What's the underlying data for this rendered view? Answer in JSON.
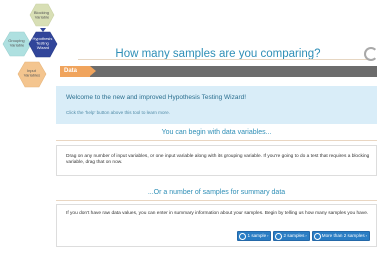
{
  "hex_menu": {
    "blocking": "Blocking\nVariable",
    "grouping": "Grouping\nVariable",
    "wizard": "Hypothesis\nTesting\nWizard",
    "input": "Input\nVariables"
  },
  "header": {
    "title": "How many samples are you comparing?"
  },
  "steps": {
    "active": "Data"
  },
  "welcome": {
    "title": "Welcome to the new and improved Hypothesis Testing Wizard!",
    "subtitle": "Click the 'help' button above this tool to learn more."
  },
  "section1": {
    "heading": "You can begin with data variables...",
    "text": "Drag on any number of input variables, or one input variable along with its grouping variable. If you're going to do a test that requires a blocking variable, drag that on now."
  },
  "section2": {
    "heading": "...Or a number of samples for summary data",
    "text": "If you don't have raw data values, you can enter in summary information about your samples. Begin by telling us how many samples you have.",
    "buttons": [
      "1 sample",
      "2 samples",
      "More than 2 samples"
    ]
  },
  "colors": {
    "hex_blocking": "#d8dfb5",
    "hex_grouping": "#aee0e0",
    "hex_wizard": "#31459a",
    "hex_input": "#f4c58f",
    "accent_orange": "#f0a45d",
    "title_blue": "#2f8fb7",
    "button_blue": "#2a7dc4"
  }
}
